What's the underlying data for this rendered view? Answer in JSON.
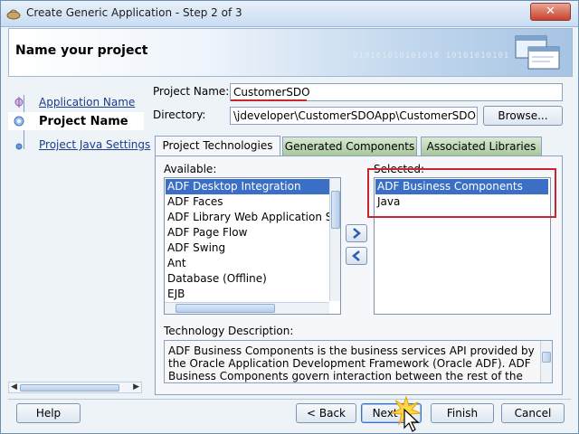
{
  "window": {
    "title": "Create Generic Application - Step 2 of 3",
    "close_label": "✕"
  },
  "header": {
    "title": "Name your project",
    "binary": "010101010101010 10101010101"
  },
  "nav": {
    "items": [
      {
        "label": "Application Name",
        "state": "link"
      },
      {
        "label": "Project Name",
        "state": "current"
      },
      {
        "label": "Project Java Settings",
        "state": "link"
      }
    ]
  },
  "form": {
    "project_name_label": "Project Name:",
    "project_name_value": "CustomerSDO",
    "directory_label": "Directory:",
    "directory_value": "\\jdeveloper\\CustomerSDOApp\\CustomerSDO",
    "browse_label": "Browse..."
  },
  "tabs": [
    "Project Technologies",
    "Generated Components",
    "Associated Libraries"
  ],
  "available": {
    "label": "Available:",
    "items": [
      "ADF Desktop Integration",
      "ADF Faces",
      "ADF Library Web Application Support",
      "ADF Page Flow",
      "ADF Swing",
      "Ant",
      "Database (Offline)",
      "EJB"
    ]
  },
  "selected": {
    "label": "Selected:",
    "items": [
      "ADF Business Components",
      "Java"
    ]
  },
  "description": {
    "label": "Technology Description:",
    "text": "ADF Business Components is the business services API provided by the Oracle Application Development Framework (Oracle ADF).  ADF Business Components govern interaction between the rest of the"
  },
  "footer": {
    "help": "Help",
    "back": "< Back",
    "next": "Next >",
    "finish": "Finish",
    "cancel": "Cancel"
  },
  "colors": {
    "accent": "#3a6fc5",
    "highlight": "#c8262e"
  }
}
